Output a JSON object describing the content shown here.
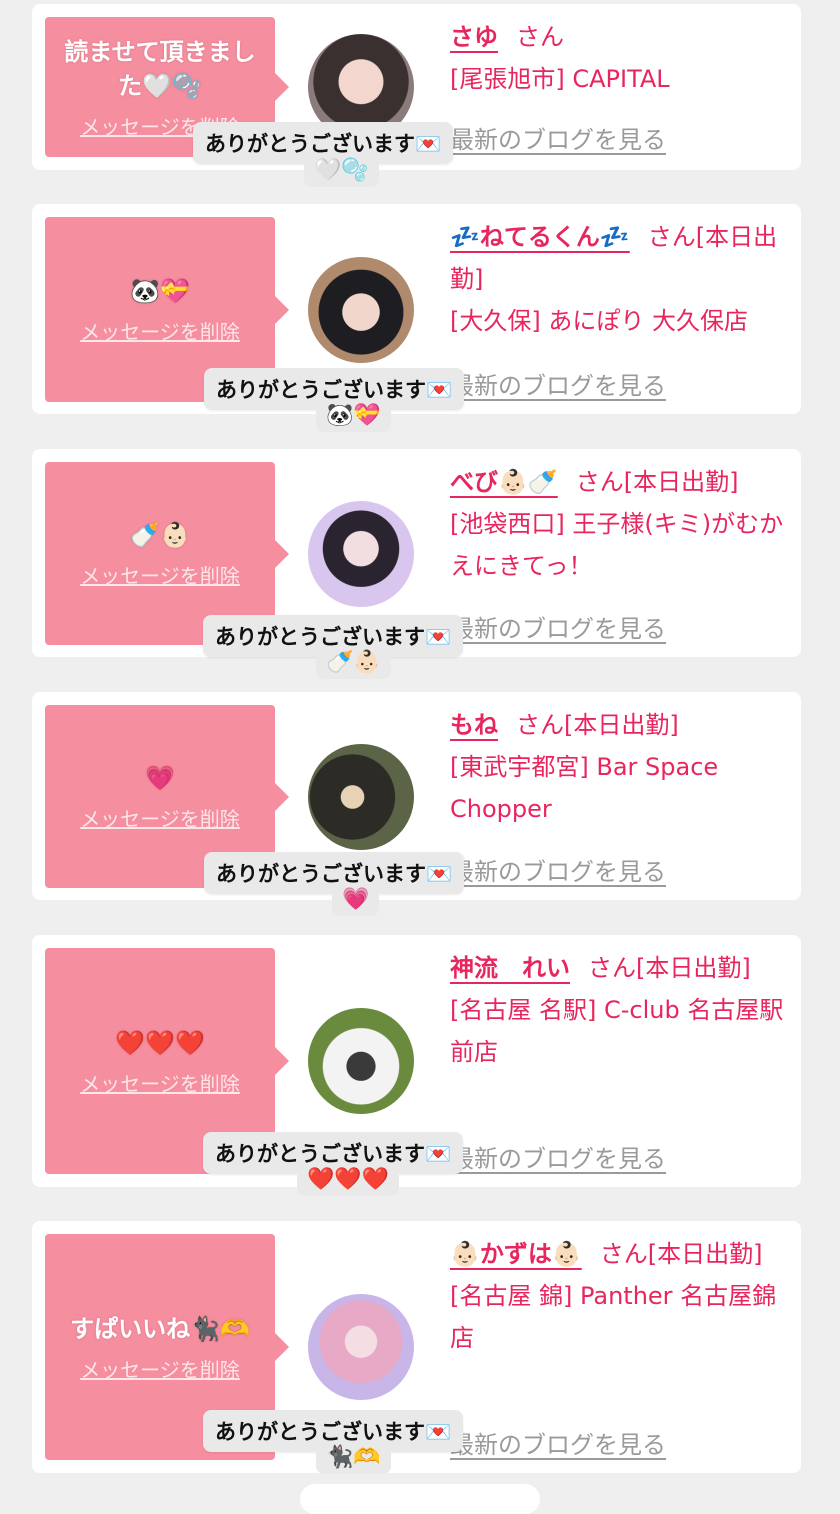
{
  "thanks": "ありがとうございます💌",
  "delete_label": "メッセージを削除",
  "blog_label": "最新のブログを見る",
  "cards": [
    {
      "message": "読ませて頂きました🤍🫧",
      "reaction": "🤍🫧",
      "name": "さゆ",
      "san": "さん",
      "shop": "[尾張旭市] CAPITAL"
    },
    {
      "message": "🐼💝",
      "reaction": "🐼💝",
      "name": "💤ねてるくん💤",
      "san": "さん[本日出勤]",
      "shop": "[大久保] あにぽり 大久保店"
    },
    {
      "message": "🍼👶🏻",
      "reaction": "🍼👶🏻",
      "name": "べび👶🏻🍼",
      "san": "さん[本日出勤]",
      "shop": "[池袋西口] 王子様(キミ)がむかえにきてっ！"
    },
    {
      "message": "💗",
      "reaction": "💗",
      "name": "もね",
      "san": "さん[本日出勤]",
      "shop": "[東武宇都宮] Bar Space Chopper"
    },
    {
      "message": "❤️❤️❤️",
      "reaction": "❤️❤️❤️",
      "name": "神流　れい",
      "san": "さん[本日出勤]",
      "shop": "[名古屋 名駅] C-club 名古屋駅前店"
    },
    {
      "message": "すぱいいね🐈‍⬛🫶",
      "reaction": "🐈‍⬛🫶",
      "name": "👶🏻かずは👶🏻",
      "san": "さん[本日出勤]",
      "shop": "[名古屋 錦] Panther 名古屋錦店"
    }
  ]
}
